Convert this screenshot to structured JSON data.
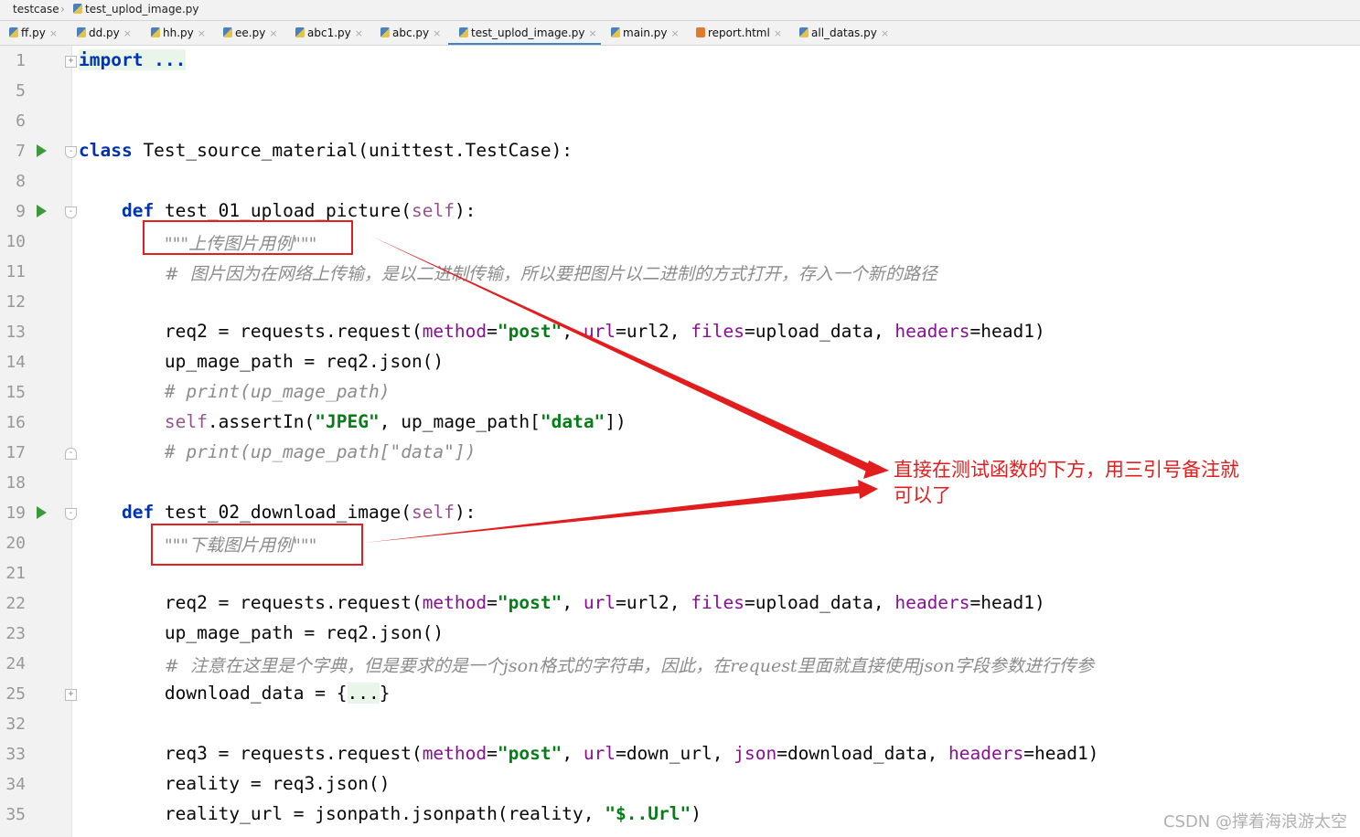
{
  "breadcrumb": [
    "testcase",
    "test_uplod_image.py"
  ],
  "tabs": [
    {
      "label": "ff.py",
      "type": "py"
    },
    {
      "label": "dd.py",
      "type": "py"
    },
    {
      "label": "hh.py",
      "type": "py"
    },
    {
      "label": "ee.py",
      "type": "py"
    },
    {
      "label": "abc1.py",
      "type": "py"
    },
    {
      "label": "abc.py",
      "type": "py"
    },
    {
      "label": "test_uplod_image.py",
      "type": "py",
      "active": true
    },
    {
      "label": "main.py",
      "type": "py"
    },
    {
      "label": "report.html",
      "type": "html"
    },
    {
      "label": "all_datas.py",
      "type": "py"
    }
  ],
  "line_numbers": [
    "1",
    "5",
    "6",
    "7",
    "8",
    "9",
    "10",
    "11",
    "12",
    "13",
    "14",
    "15",
    "16",
    "17",
    "18",
    "19",
    "20",
    "21",
    "22",
    "23",
    "24",
    "25",
    "32",
    "33",
    "34",
    "35"
  ],
  "run_markers_lines": [
    "7",
    "9",
    "19"
  ],
  "code": {
    "l1": "import ...",
    "l7_kw": "class",
    "l7_rest": " Test_source_material(unittest.TestCase):",
    "def": "def",
    "l9_name": " test_01_upload_picture(",
    "self": "self",
    "close_colon": "):",
    "l10": "\"\"\"上传图片用例\"\"\"",
    "l11": "#  图片因为在网络上传输，是以二进制传输，所以要把图片以二进制的方式打开，存入一个新的路径",
    "req2_assign": "req2 = requests.request(",
    "method_kw": "method",
    "eq": "=",
    "post_str": "\"post\"",
    "comma": ", ",
    "url_kw": "url",
    "url2": "url2",
    "files_kw": "files",
    "upload_data": "upload_data",
    "headers_kw": "headers",
    "head1_close": "head1)",
    "l14": "up_mage_path = req2.json()",
    "l15": "# print(up_mage_path)",
    "l16_self": "self",
    "l16_a": ".assertIn(",
    "jpeg_str": "\"JPEG\"",
    "l16_b": ", up_mage_path[",
    "data_str": "\"data\"",
    "l16_c": "])",
    "l17": "# print(up_mage_path[\"data\"])",
    "l19_name": " test_02_download_image(",
    "l20": "\"\"\"下载图片用例\"\"\"",
    "l24": "#  注意在这里是个字典，但是要求的是一个json格式的字符串，因此，在request里面就直接使用json字段参数进行传参",
    "l25_a": "download_data = {",
    "l25_b": "...",
    "l25_c": "}",
    "req3_assign": "req3 = requests.request(",
    "down_url": "down_url",
    "json_kw": "json",
    "download_data": "download_data",
    "l34": "reality = req3.json()",
    "l35_a": "reality_url = jsonpath.jsonpath(reality, ",
    "l35_str": "\"$..Url\"",
    "l35_b": ")"
  },
  "annotation": "直接在测试函数的下方，用三引号备注就可以了",
  "watermark": "CSDN @撑着海浪游太空",
  "colors": {
    "keyword": "#0033b3",
    "string": "#067d17",
    "param": "#871094",
    "comment": "#8c8c8c",
    "annotation": "#e21d1d",
    "run": "#3c9a3c"
  }
}
